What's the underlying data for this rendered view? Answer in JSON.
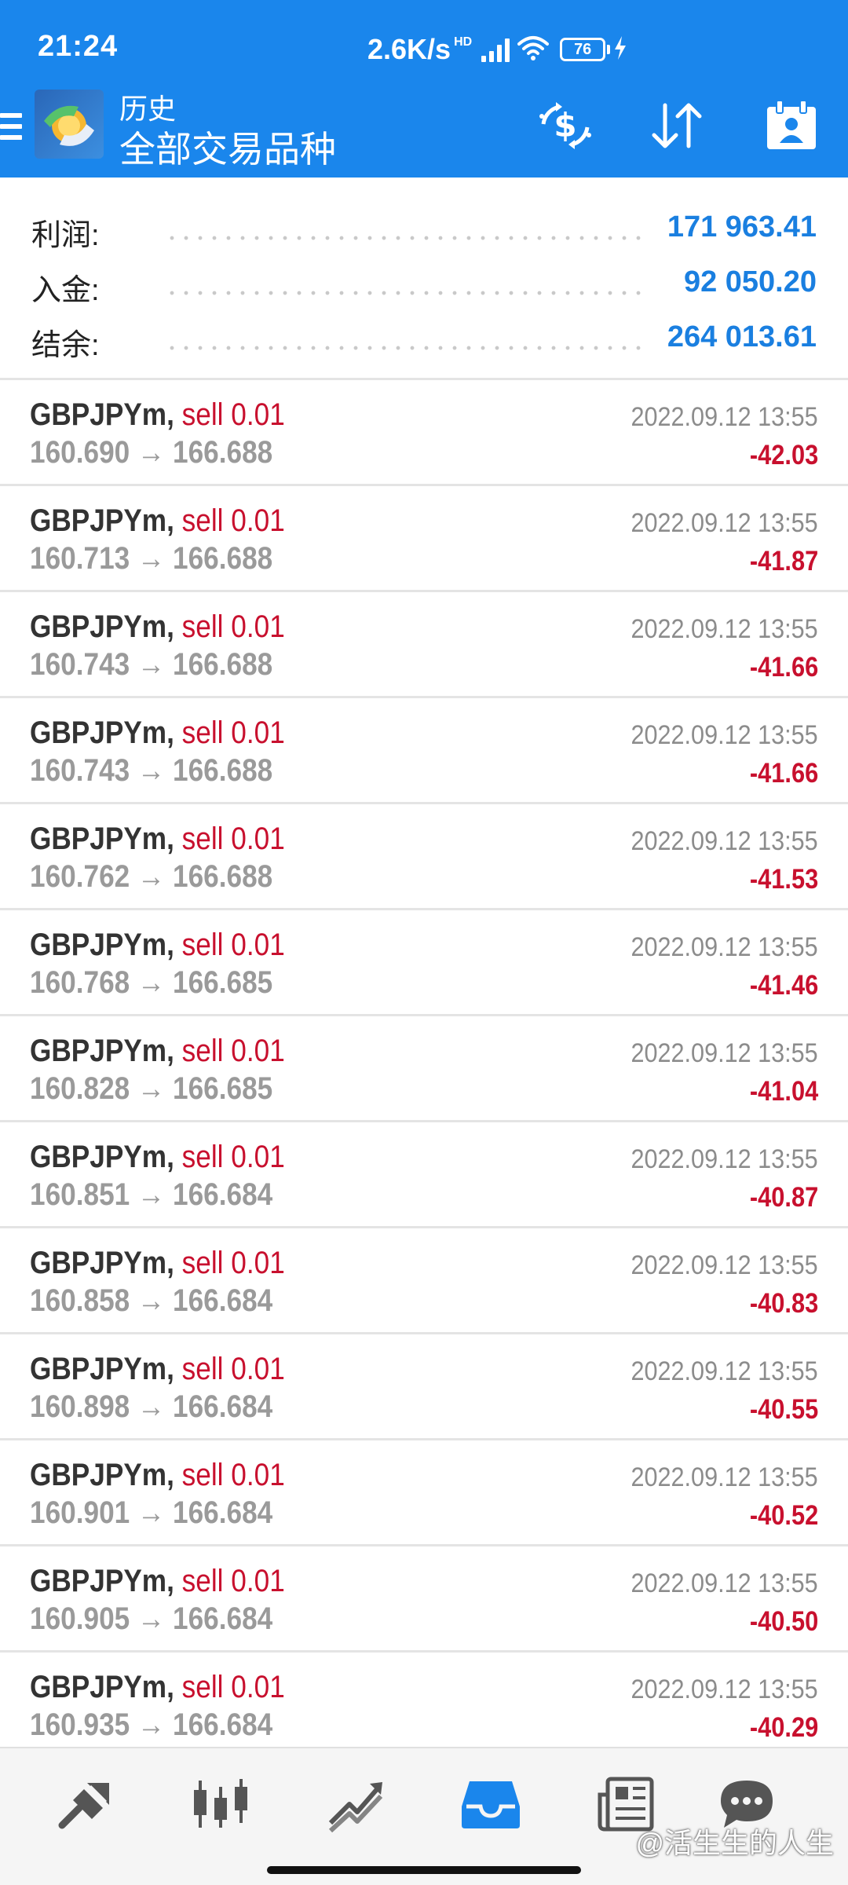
{
  "status_bar": {
    "time": "21:24",
    "network_speed": "2.6K/s",
    "hd_badge": "HD",
    "battery_level": "76",
    "icons": [
      "signal-icon",
      "wifi-icon",
      "battery-icon",
      "charging-icon"
    ]
  },
  "app_bar": {
    "title_small": "历史",
    "title_main": "全部交易品种",
    "icons": [
      "menu-icon",
      "currency-exchange-icon",
      "sort-icon",
      "calendar-person-icon"
    ]
  },
  "summary": {
    "profit_label": "利润:",
    "profit_value": "171 963.41",
    "deposit_label": "入金:",
    "deposit_value": "92 050.20",
    "balance_label": "结余:",
    "balance_value": "264 013.61"
  },
  "deals": [
    {
      "symbol": "GBPJPYm,",
      "side": "sell 0.01",
      "prices": "160.690 → 166.688",
      "time": "2022.09.12 13:55",
      "profit": "-42.03"
    },
    {
      "symbol": "GBPJPYm,",
      "side": "sell 0.01",
      "prices": "160.713 → 166.688",
      "time": "2022.09.12 13:55",
      "profit": "-41.87"
    },
    {
      "symbol": "GBPJPYm,",
      "side": "sell 0.01",
      "prices": "160.743 → 166.688",
      "time": "2022.09.12 13:55",
      "profit": "-41.66"
    },
    {
      "symbol": "GBPJPYm,",
      "side": "sell 0.01",
      "prices": "160.743 → 166.688",
      "time": "2022.09.12 13:55",
      "profit": "-41.66"
    },
    {
      "symbol": "GBPJPYm,",
      "side": "sell 0.01",
      "prices": "160.762 → 166.688",
      "time": "2022.09.12 13:55",
      "profit": "-41.53"
    },
    {
      "symbol": "GBPJPYm,",
      "side": "sell 0.01",
      "prices": "160.768 → 166.685",
      "time": "2022.09.12 13:55",
      "profit": "-41.46"
    },
    {
      "symbol": "GBPJPYm,",
      "side": "sell 0.01",
      "prices": "160.828 → 166.685",
      "time": "2022.09.12 13:55",
      "profit": "-41.04"
    },
    {
      "symbol": "GBPJPYm,",
      "side": "sell 0.01",
      "prices": "160.851 → 166.684",
      "time": "2022.09.12 13:55",
      "profit": "-40.87"
    },
    {
      "symbol": "GBPJPYm,",
      "side": "sell 0.01",
      "prices": "160.858 → 166.684",
      "time": "2022.09.12 13:55",
      "profit": "-40.83"
    },
    {
      "symbol": "GBPJPYm,",
      "side": "sell 0.01",
      "prices": "160.898 → 166.684",
      "time": "2022.09.12 13:55",
      "profit": "-40.55"
    },
    {
      "symbol": "GBPJPYm,",
      "side": "sell 0.01",
      "prices": "160.901 → 166.684",
      "time": "2022.09.12 13:55",
      "profit": "-40.52"
    },
    {
      "symbol": "GBPJPYm,",
      "side": "sell 0.01",
      "prices": "160.905 → 166.684",
      "time": "2022.09.12 13:55",
      "profit": "-40.50"
    },
    {
      "symbol": "GBPJPYm,",
      "side": "sell 0.01",
      "prices": "160.935 → 166.684",
      "time": "2022.09.12 13:55",
      "profit": "-40.29"
    }
  ],
  "bottom_nav": {
    "items": [
      "quotes-icon",
      "chart-candles-icon",
      "trade-icon",
      "history-icon",
      "news-icon",
      "messages-icon"
    ],
    "active": "history-icon",
    "watermark": "@活生生的人生"
  },
  "colors": {
    "header_blue": "#1a86ec",
    "value_blue": "#1a7fe0",
    "sell_red": "#c8102e",
    "active_nav": "#1a86ec"
  }
}
